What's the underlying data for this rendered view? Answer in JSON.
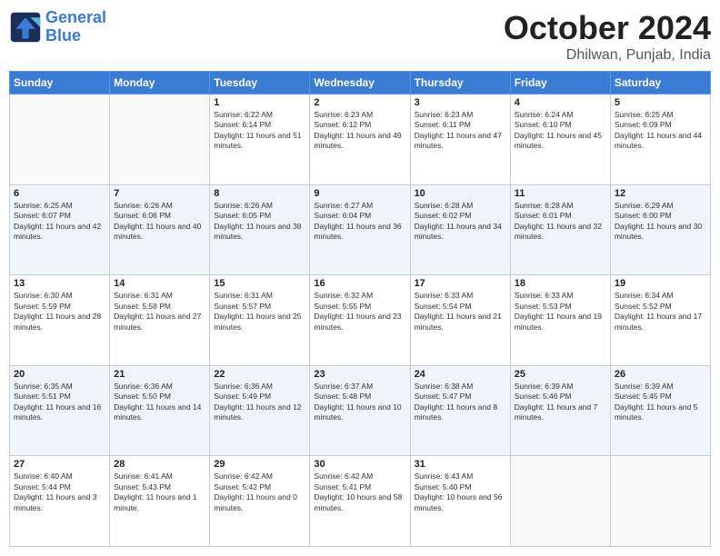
{
  "header": {
    "logo_line1": "General",
    "logo_line2": "Blue",
    "month": "October 2024",
    "location": "Dhilwan, Punjab, India"
  },
  "weekdays": [
    "Sunday",
    "Monday",
    "Tuesday",
    "Wednesday",
    "Thursday",
    "Friday",
    "Saturday"
  ],
  "weeks": [
    [
      {
        "day": "",
        "info": ""
      },
      {
        "day": "",
        "info": ""
      },
      {
        "day": "1",
        "info": "Sunrise: 6:22 AM\nSunset: 6:14 PM\nDaylight: 11 hours and 51 minutes."
      },
      {
        "day": "2",
        "info": "Sunrise: 6:23 AM\nSunset: 6:12 PM\nDaylight: 11 hours and 49 minutes."
      },
      {
        "day": "3",
        "info": "Sunrise: 6:23 AM\nSunset: 6:11 PM\nDaylight: 11 hours and 47 minutes."
      },
      {
        "day": "4",
        "info": "Sunrise: 6:24 AM\nSunset: 6:10 PM\nDaylight: 11 hours and 45 minutes."
      },
      {
        "day": "5",
        "info": "Sunrise: 6:25 AM\nSunset: 6:09 PM\nDaylight: 11 hours and 44 minutes."
      }
    ],
    [
      {
        "day": "6",
        "info": "Sunrise: 6:25 AM\nSunset: 6:07 PM\nDaylight: 11 hours and 42 minutes."
      },
      {
        "day": "7",
        "info": "Sunrise: 6:26 AM\nSunset: 6:06 PM\nDaylight: 11 hours and 40 minutes."
      },
      {
        "day": "8",
        "info": "Sunrise: 6:26 AM\nSunset: 6:05 PM\nDaylight: 11 hours and 38 minutes."
      },
      {
        "day": "9",
        "info": "Sunrise: 6:27 AM\nSunset: 6:04 PM\nDaylight: 11 hours and 36 minutes."
      },
      {
        "day": "10",
        "info": "Sunrise: 6:28 AM\nSunset: 6:02 PM\nDaylight: 11 hours and 34 minutes."
      },
      {
        "day": "11",
        "info": "Sunrise: 6:28 AM\nSunset: 6:01 PM\nDaylight: 11 hours and 32 minutes."
      },
      {
        "day": "12",
        "info": "Sunrise: 6:29 AM\nSunset: 6:00 PM\nDaylight: 11 hours and 30 minutes."
      }
    ],
    [
      {
        "day": "13",
        "info": "Sunrise: 6:30 AM\nSunset: 5:59 PM\nDaylight: 11 hours and 28 minutes."
      },
      {
        "day": "14",
        "info": "Sunrise: 6:31 AM\nSunset: 5:58 PM\nDaylight: 11 hours and 27 minutes."
      },
      {
        "day": "15",
        "info": "Sunrise: 6:31 AM\nSunset: 5:57 PM\nDaylight: 11 hours and 25 minutes."
      },
      {
        "day": "16",
        "info": "Sunrise: 6:32 AM\nSunset: 5:55 PM\nDaylight: 11 hours and 23 minutes."
      },
      {
        "day": "17",
        "info": "Sunrise: 6:33 AM\nSunset: 5:54 PM\nDaylight: 11 hours and 21 minutes."
      },
      {
        "day": "18",
        "info": "Sunrise: 6:33 AM\nSunset: 5:53 PM\nDaylight: 11 hours and 19 minutes."
      },
      {
        "day": "19",
        "info": "Sunrise: 6:34 AM\nSunset: 5:52 PM\nDaylight: 11 hours and 17 minutes."
      }
    ],
    [
      {
        "day": "20",
        "info": "Sunrise: 6:35 AM\nSunset: 5:51 PM\nDaylight: 11 hours and 16 minutes."
      },
      {
        "day": "21",
        "info": "Sunrise: 6:36 AM\nSunset: 5:50 PM\nDaylight: 11 hours and 14 minutes."
      },
      {
        "day": "22",
        "info": "Sunrise: 6:36 AM\nSunset: 5:49 PM\nDaylight: 11 hours and 12 minutes."
      },
      {
        "day": "23",
        "info": "Sunrise: 6:37 AM\nSunset: 5:48 PM\nDaylight: 11 hours and 10 minutes."
      },
      {
        "day": "24",
        "info": "Sunrise: 6:38 AM\nSunset: 5:47 PM\nDaylight: 11 hours and 8 minutes."
      },
      {
        "day": "25",
        "info": "Sunrise: 6:39 AM\nSunset: 5:46 PM\nDaylight: 11 hours and 7 minutes."
      },
      {
        "day": "26",
        "info": "Sunrise: 6:39 AM\nSunset: 5:45 PM\nDaylight: 11 hours and 5 minutes."
      }
    ],
    [
      {
        "day": "27",
        "info": "Sunrise: 6:40 AM\nSunset: 5:44 PM\nDaylight: 11 hours and 3 minutes."
      },
      {
        "day": "28",
        "info": "Sunrise: 6:41 AM\nSunset: 5:43 PM\nDaylight: 11 hours and 1 minute."
      },
      {
        "day": "29",
        "info": "Sunrise: 6:42 AM\nSunset: 5:42 PM\nDaylight: 11 hours and 0 minutes."
      },
      {
        "day": "30",
        "info": "Sunrise: 6:42 AM\nSunset: 5:41 PM\nDaylight: 10 hours and 58 minutes."
      },
      {
        "day": "31",
        "info": "Sunrise: 6:43 AM\nSunset: 5:40 PM\nDaylight: 10 hours and 56 minutes."
      },
      {
        "day": "",
        "info": ""
      },
      {
        "day": "",
        "info": ""
      }
    ]
  ]
}
